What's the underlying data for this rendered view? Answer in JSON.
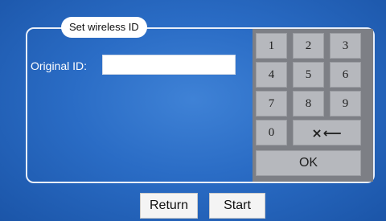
{
  "panel": {
    "title": "Set wireless ID",
    "original_id_label": "Original ID:",
    "original_id_value": ""
  },
  "keypad": {
    "keys": [
      "1",
      "2",
      "3",
      "4",
      "5",
      "6",
      "7",
      "8",
      "9",
      "0"
    ],
    "backspace_label": "×⟵",
    "ok_label": "OK"
  },
  "footer": {
    "return_label": "Return",
    "start_label": "Start"
  }
}
